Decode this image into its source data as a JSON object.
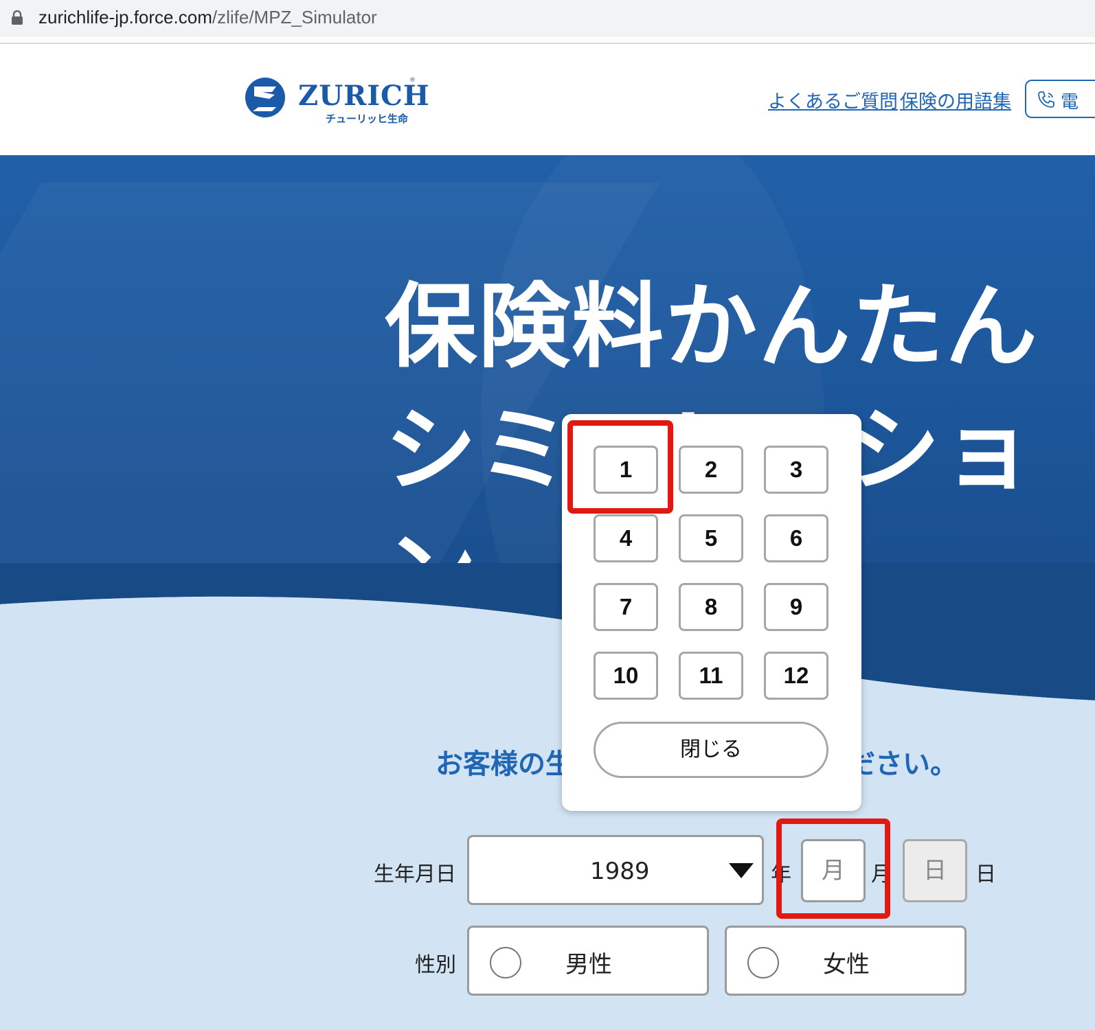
{
  "browser": {
    "url_domain": "zurichlife-jp.force.com",
    "url_path": "/zlife/MPZ_Simulator"
  },
  "header": {
    "logo_wordmark": "ZURICH",
    "logo_sub": "チューリッヒ生命",
    "logo_mark": "Z",
    "nav": {
      "faq": "よくあるご質問",
      "glossary": "保険の用語集",
      "phone": "電"
    }
  },
  "hero": {
    "title_line1": "保険料かんたん",
    "title_line2": "シミュレーション"
  },
  "main": {
    "prompt": "お客様の生年月日と性別を入力ください。"
  },
  "form": {
    "dob_label": "生年月日",
    "year_value": "1989",
    "year_unit": "年",
    "month_placeholder": "月",
    "month_unit": "月",
    "day_placeholder": "日",
    "day_unit": "日",
    "gender_label": "性別",
    "male": "男性",
    "female": "女性"
  },
  "month_picker": {
    "months": [
      "1",
      "2",
      "3",
      "4",
      "5",
      "6",
      "7",
      "8",
      "9",
      "10",
      "11",
      "12"
    ],
    "close_label": "閉じる"
  },
  "colors": {
    "brand_blue": "#1f66b5",
    "hero_blue": "#1d579c",
    "content_bg": "#d2e3f4",
    "highlight_red": "#e01a12"
  }
}
